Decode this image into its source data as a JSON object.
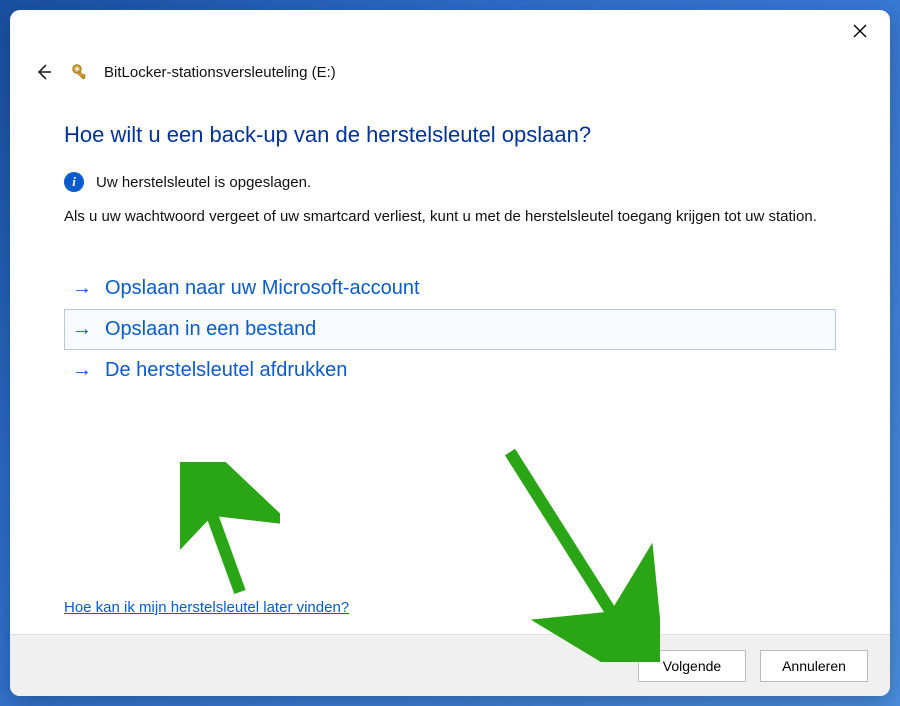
{
  "window": {
    "title": "BitLocker-stationsversleuteling (E:)"
  },
  "heading": "Hoe wilt u een back-up van de herstelsleutel opslaan?",
  "info": {
    "icon_glyph": "i",
    "text": "Uw herstelsleutel is opgeslagen."
  },
  "body_text": "Als u uw wachtwoord vergeet of uw smartcard verliest, kunt u met de herstelsleutel toegang krijgen tot uw station.",
  "options": [
    {
      "label": "Opslaan naar uw Microsoft-account"
    },
    {
      "label": "Opslaan in een bestand"
    },
    {
      "label": "De herstelsleutel afdrukken"
    }
  ],
  "help_link": "Hoe kan ik mijn herstelsleutel later vinden?",
  "footer": {
    "next": "Volgende",
    "cancel": "Annuleren"
  },
  "colors": {
    "link": "#0a5bcc",
    "heading": "#003399",
    "annotation_arrow": "#2aa515"
  }
}
